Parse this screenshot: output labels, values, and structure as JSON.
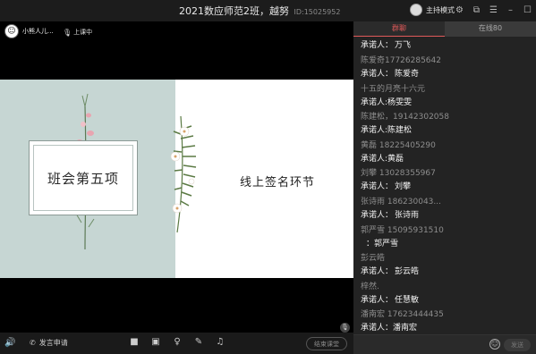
{
  "window": {
    "title": "2021数应师范2班，越努",
    "id_label": "ID:15025952",
    "host_mode": "主持模式"
  },
  "teacher": {
    "name": "小熊人儿...",
    "status": "上课中"
  },
  "slide": {
    "title": "班会第五项",
    "subtitle": "线上签名环节"
  },
  "bottombar": {
    "apply_label": "发言申请",
    "end_label": "结束课堂"
  },
  "chat": {
    "tabs": [
      {
        "label": "群聊",
        "active": true
      },
      {
        "label": "在线80",
        "active": false
      }
    ],
    "messages": [
      {
        "sender": "",
        "text_prefix": "承诺人：",
        "text_value": "万飞"
      },
      {
        "sender": "陈爱奇17726285642",
        "text_prefix": "承诺人：",
        "text_value": "陈爱奇"
      },
      {
        "sender": "十五的月亮十六元",
        "text_prefix": "承诺人:",
        "text_value": "杨雯雯"
      },
      {
        "sender": "陈建松，19142302058",
        "text_prefix": "承诺人:",
        "text_value": "陈建松"
      },
      {
        "sender": "黄磊 18225405290",
        "text_prefix": "承诺人:",
        "text_value": "黄磊"
      },
      {
        "sender": "刘攀 13028355967",
        "text_prefix": "承诺人：",
        "text_value": "刘攀"
      },
      {
        "sender": "张诗雨  186230043...",
        "text_prefix": "承诺人：",
        "text_value": "张诗雨"
      },
      {
        "sender": "郭严雪 15095931510",
        "text_prefix": "：",
        "text_value": "郭严雪"
      },
      {
        "sender": "彭云皓",
        "text_prefix": "承诺人：",
        "text_value": "彭云皓"
      },
      {
        "sender": "梓然.",
        "text_prefix": "承诺人：",
        "text_value": "任慧敏"
      },
      {
        "sender": "潘南宏 17623444435",
        "text_prefix": "承诺人：",
        "text_value": "潘南宏"
      }
    ],
    "send_label": "发送"
  },
  "icons": {
    "host_avatar": "avatar-icon",
    "settings": "gear-icon",
    "popout": "popout-icon",
    "menu": "menu-icon",
    "minimize": "minimize-icon",
    "maximize": "maximize-icon",
    "close": "close-icon",
    "volume": "speaker-icon",
    "phone": "phone-icon",
    "camera": "camera-icon",
    "screen": "screen-share-icon",
    "mic": "mic-icon",
    "edit": "edit-icon",
    "music": "music-icon",
    "emoji": "emoji-icon"
  },
  "colors": {
    "accent": "#e05a5a",
    "slide_left_bg": "#c6d6d3"
  }
}
